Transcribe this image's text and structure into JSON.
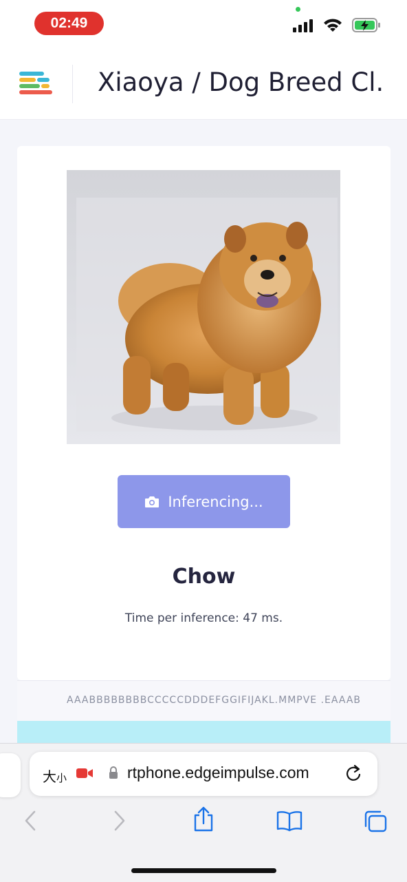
{
  "status_bar": {
    "time": "02:49",
    "icons": [
      "cellular-signal-icon",
      "wifi-icon",
      "battery-charging-icon"
    ]
  },
  "header": {
    "project_title": "Xiaoya / Dog Breed Cl...",
    "logo_icon": "edge-impulse-logo-icon"
  },
  "classifier": {
    "image_alt": "Chow Chow dog photo",
    "button_label": "Inferencing...",
    "button_icon": "camera-icon",
    "result_label": "Chow",
    "timing_text": "Time per inference: 47 ms."
  },
  "labels_strip": {
    "text": "AAABBBBBBBBCCCCCDDDEFGGIFIJAKL.MMPVE .EAAAB"
  },
  "browser": {
    "aa_label_big": "大",
    "aa_label_small": "小",
    "url": "rtphone.edgeimpulse.com",
    "toolbar_icons": [
      "back-icon",
      "forward-icon",
      "share-icon",
      "bookmarks-icon",
      "tabs-icon"
    ]
  },
  "colors": {
    "time_pill": "#e0322d",
    "button_bg": "#8d97ea",
    "accent_cyan": "#b8eef8",
    "link_blue": "#1a73e8"
  }
}
